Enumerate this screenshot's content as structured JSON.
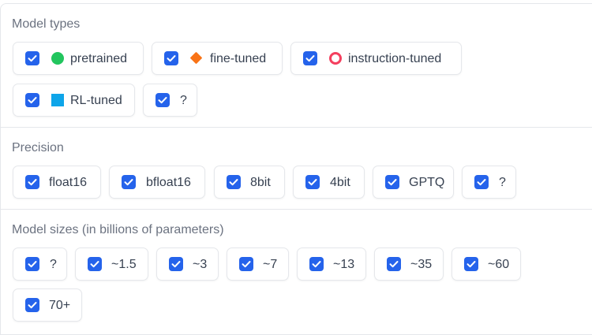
{
  "model_types": {
    "label": "Model types",
    "options": [
      {
        "label": "pretrained",
        "checked": true,
        "symbol": "circle",
        "color": "#22c55e"
      },
      {
        "label": "fine-tuned",
        "checked": true,
        "symbol": "diamond",
        "color": "#f97316"
      },
      {
        "label": "instruction-tuned",
        "checked": true,
        "symbol": "ring",
        "color": "#f43f5e"
      },
      {
        "label": "RL-tuned",
        "checked": true,
        "symbol": "square",
        "color": "#0ea5e9"
      },
      {
        "label": "?",
        "checked": true
      }
    ]
  },
  "precision": {
    "label": "Precision",
    "options": [
      {
        "label": "float16",
        "checked": true
      },
      {
        "label": "bfloat16",
        "checked": true
      },
      {
        "label": "8bit",
        "checked": true
      },
      {
        "label": "4bit",
        "checked": true
      },
      {
        "label": "GPTQ",
        "checked": true
      },
      {
        "label": "?",
        "checked": true
      }
    ]
  },
  "model_sizes": {
    "label": "Model sizes (in billions of parameters)",
    "options": [
      {
        "label": "?",
        "checked": true
      },
      {
        "label": "~1.5",
        "checked": true
      },
      {
        "label": "~3",
        "checked": true
      },
      {
        "label": "~7",
        "checked": true
      },
      {
        "label": "~13",
        "checked": true
      },
      {
        "label": "~35",
        "checked": true
      },
      {
        "label": "~60",
        "checked": true
      },
      {
        "label": "70+",
        "checked": true
      }
    ]
  },
  "colors": {
    "checkbox": "#2563eb",
    "chip_border": "#e5e7eb"
  }
}
